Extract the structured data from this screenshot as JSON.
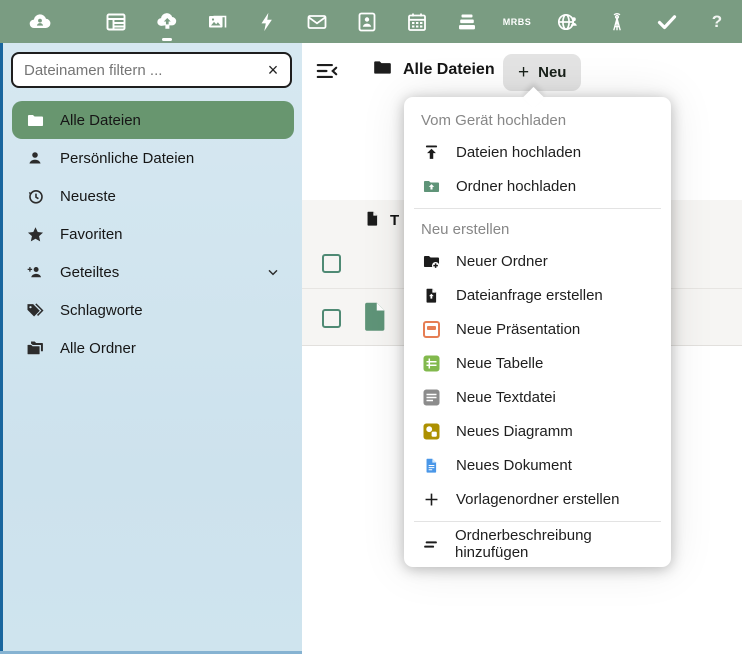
{
  "colors": {
    "topbar_green": "#7a9c82",
    "sidebar_blue": "#cde2ed",
    "sidebar_edge_blue": "#19669e",
    "selected_item_green": "#68966f",
    "checkbox_green": "#4f8a74",
    "file_icon_green": "#5f9478",
    "presentation_orange": "#e67e54",
    "table_green": "#82b94d",
    "textfile_grey": "#8c8c8c",
    "diagram_olive": "#ad9000",
    "document_blue": "#4a97e8"
  },
  "topbar": {
    "apps": [
      {
        "name": "nextcloud-logo"
      },
      {
        "name": "dashboard"
      },
      {
        "name": "files",
        "active": true
      },
      {
        "name": "photos"
      },
      {
        "name": "activity"
      },
      {
        "name": "mail"
      },
      {
        "name": "contacts"
      },
      {
        "name": "calendar"
      },
      {
        "name": "deck"
      },
      {
        "name": "mrbs",
        "label": "MRBS"
      },
      {
        "name": "intranet"
      },
      {
        "name": "antenna"
      },
      {
        "name": "tasks"
      },
      {
        "name": "help",
        "label": "?"
      }
    ]
  },
  "sidebar": {
    "filter_placeholder": "Dateinamen filtern ...",
    "clear_label": "×",
    "items": [
      {
        "label": "Alle Dateien",
        "selected": true
      },
      {
        "label": "Persönliche Dateien"
      },
      {
        "label": "Neueste"
      },
      {
        "label": "Favoriten"
      },
      {
        "label": "Geteiltes",
        "expandable": true
      },
      {
        "label": "Schlagworte"
      },
      {
        "label": "Alle Ordner"
      }
    ]
  },
  "header": {
    "breadcrumb": "Alle Dateien",
    "new_button_icon": "+",
    "new_button_label": "Neu"
  },
  "filelist": {
    "type_chip_label": "T"
  },
  "menu": {
    "section_upload": "Vom Gerät hochladen",
    "section_create": "Neu erstellen",
    "items": [
      {
        "label": "Dateien hochladen"
      },
      {
        "label": "Ordner hochladen"
      },
      {
        "label": "Neuer Ordner"
      },
      {
        "label": "Dateianfrage erstellen"
      },
      {
        "label": "Neue Präsentation"
      },
      {
        "label": "Neue Tabelle"
      },
      {
        "label": "Neue Textdatei"
      },
      {
        "label": "Neues Diagramm"
      },
      {
        "label": "Neues Dokument"
      },
      {
        "label": "Vorlagenordner erstellen"
      },
      {
        "label": "Ordnerbeschreibung hinzufügen"
      }
    ]
  }
}
